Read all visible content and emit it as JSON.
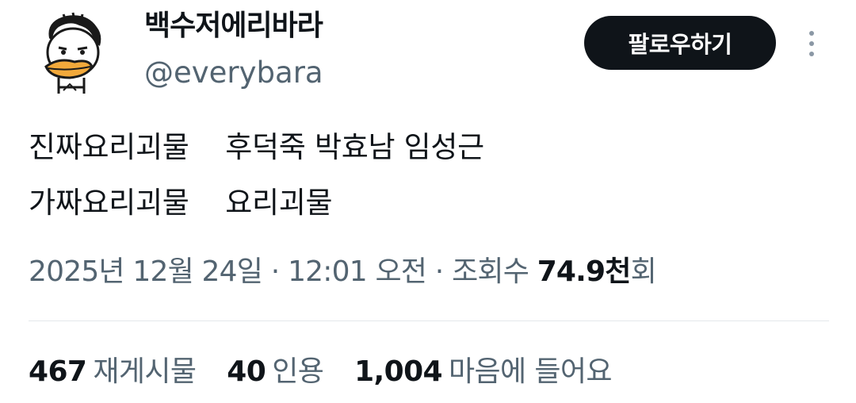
{
  "profile": {
    "display_name": "백수저에리바라",
    "handle": "@everybara",
    "follow_label": "팔로우하기"
  },
  "tweet": {
    "lines": [
      "진짜요리괴물    후덕죽 박효남 임성근",
      "가짜요리괴물    요리괴물"
    ]
  },
  "meta": {
    "date": "2025년 12월 24일",
    "separator": "·",
    "time": "12:01 오전",
    "views_label": "조회수",
    "views_num": "74.9천",
    "views_suffix": "회"
  },
  "stats": {
    "reposts": {
      "num": "467",
      "label": "재게시물"
    },
    "quotes": {
      "num": "40",
      "label": "인용"
    },
    "likes": {
      "num": "1,004",
      "label": "마음에 들어요"
    }
  },
  "colors": {
    "text": "#0f1419",
    "secondary": "#536471",
    "button_bg": "#0f1419",
    "divider": "#e4e8eb"
  },
  "icons": {
    "avatar": "duck-cartoon-avatar",
    "more": "more-vertical-icon"
  }
}
